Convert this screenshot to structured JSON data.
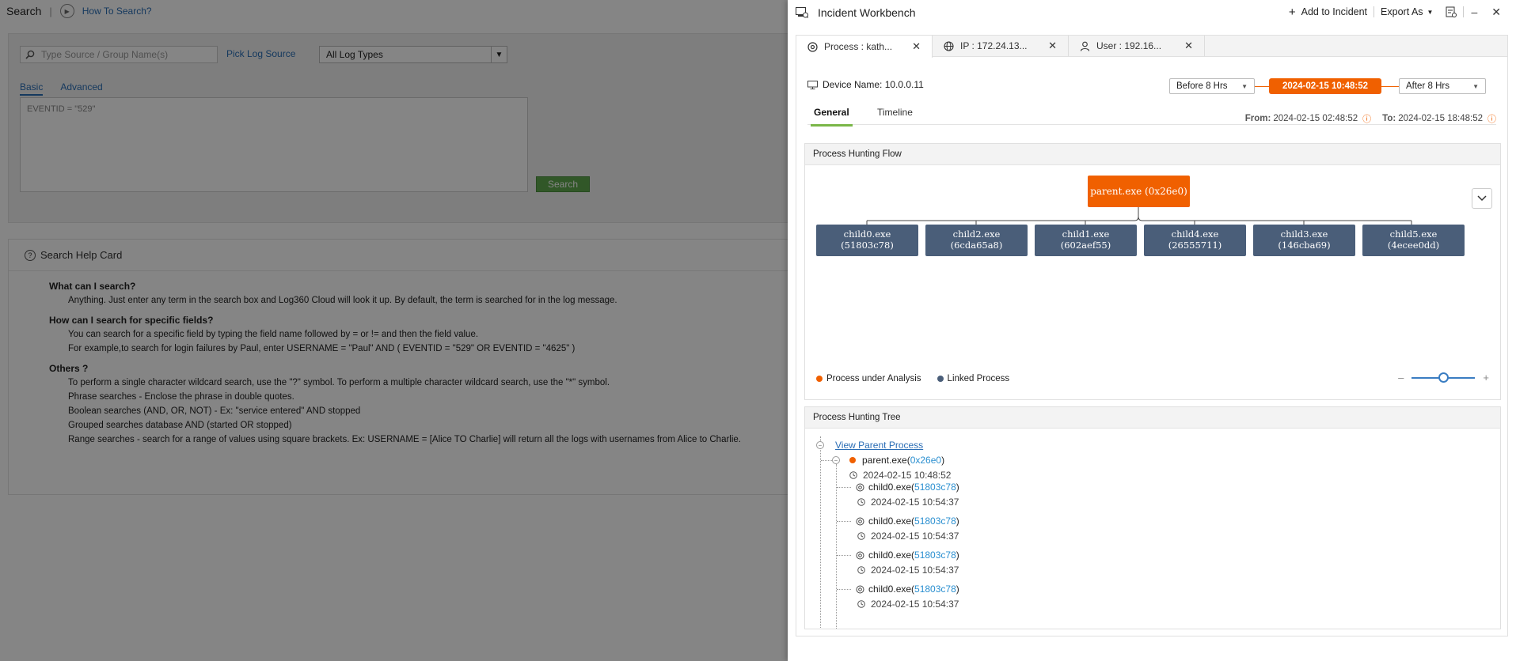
{
  "page": {
    "title": "Search",
    "how_to": "How To Search?"
  },
  "search": {
    "source_placeholder": "Type Source / Group Name(s)",
    "pick_log_source": "Pick Log Source",
    "log_types": "All Log Types",
    "tab_basic": "Basic",
    "tab_advanced": "Advanced",
    "query": "EVENTID = \"529\"",
    "button": "Search"
  },
  "help": {
    "title": "Search Help Card",
    "sections": [
      {
        "heading": "What can I search?",
        "items": [
          "Anything. Just enter any term in the search box and Log360 Cloud will look it up. By default, the term is searched for in the log message."
        ]
      },
      {
        "heading": "How can I search for specific fields?",
        "items": [
          "You can search for a specific field by typing the field name followed by = or != and then the field value.",
          "For example,to search for login failures by Paul, enter USERNAME = \"Paul\" AND ( EVENTID = \"529\" OR EVENTID = \"4625\" )"
        ]
      },
      {
        "heading": "Others ?",
        "items": [
          "To perform a single character wildcard search, use the \"?\" symbol. To perform a multiple character wildcard search, use the \"*\" symbol.",
          "Phrase searches - Enclose the phrase in double quotes.",
          "Boolean searches (AND, OR, NOT) - Ex: \"service entered\" AND stopped",
          "Grouped searches database AND (started OR stopped)",
          "Range searches - search for a range of values using square brackets. Ex: USERNAME = [Alice TO Charlie] will return all the logs with usernames from Alice to Charlie."
        ]
      }
    ]
  },
  "workbench": {
    "title": "Incident Workbench",
    "add_to_incident": "Add to Incident",
    "export_as": "Export As",
    "tabs": [
      {
        "label": "Process : kath...",
        "icon": "process-icon"
      },
      {
        "label": "IP : 172.24.13...",
        "icon": "globe-icon"
      },
      {
        "label": "User : 192.16...",
        "icon": "user-icon"
      }
    ],
    "device_label": "Device Name: 10.0.0.11",
    "before": "Before 8 Hrs",
    "center_time": "2024-02-15 10:48:52",
    "after": "After 8 Hrs",
    "subtab_general": "General",
    "subtab_timeline": "Timeline",
    "from_label": "From:",
    "from_value": "2024-02-15 02:48:52",
    "to_label": "To:",
    "to_value": "2024-02-15 18:48:52",
    "flow": {
      "title": "Process Hunting Flow",
      "parent": "parent.exe (0x26e0)",
      "children": [
        {
          "name": "child0.exe",
          "id": "(51803c78)"
        },
        {
          "name": "child2.exe",
          "id": "(6cda65a8)"
        },
        {
          "name": "child1.exe",
          "id": "(602aef55)"
        },
        {
          "name": "child4.exe",
          "id": "(26555711)"
        },
        {
          "name": "child3.exe",
          "id": "(146cba69)"
        },
        {
          "name": "child5.exe",
          "id": "(4ecee0dd)"
        }
      ],
      "legend_analysis": "Process under Analysis",
      "legend_linked": "Linked Process",
      "zoom_minus": "–",
      "zoom_plus": "+",
      "zoom_level": 0.5
    },
    "tree": {
      "title": "Process Hunting Tree",
      "view_parent": "View Parent Process",
      "parent_name": "parent.exe(",
      "parent_pid": "0x26e0",
      "parent_close": ")",
      "parent_time": "2024-02-15 10:48:52",
      "children": [
        {
          "name": "child0.exe(",
          "pid": "51803c78",
          "close": ")",
          "time": "2024-02-15 10:54:37"
        },
        {
          "name": "child0.exe(",
          "pid": "51803c78",
          "close": ")",
          "time": "2024-02-15 10:54:37"
        },
        {
          "name": "child0.exe(",
          "pid": "51803c78",
          "close": ")",
          "time": "2024-02-15 10:54:37"
        },
        {
          "name": "child0.exe(",
          "pid": "51803c78",
          "close": ")",
          "time": "2024-02-15 10:54:37"
        }
      ]
    }
  },
  "colors": {
    "accent": "#f06000",
    "linked": "#4a5e79",
    "link": "#2a6db5",
    "green": "#7ab648"
  }
}
